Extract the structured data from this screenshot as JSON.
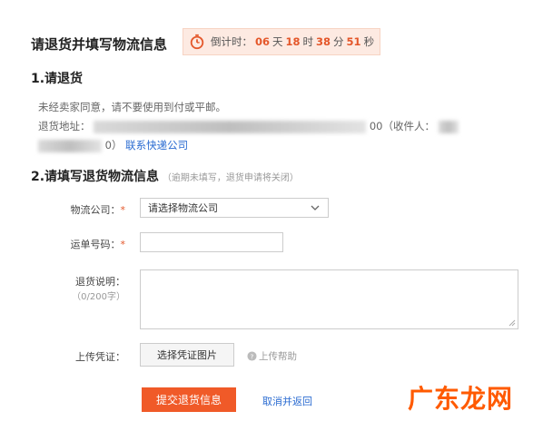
{
  "page_title": "请退货并填写物流信息",
  "countdown": {
    "label": "倒计时：",
    "days": "06",
    "days_unit": "天",
    "hours": "18",
    "hours_unit": "时",
    "minutes": "38",
    "minutes_unit": "分",
    "seconds": "51",
    "seconds_unit": "秒"
  },
  "step1": {
    "title": "1.请退货",
    "note": "未经卖家同意，请不要使用到付或平邮。",
    "address_label": "退货地址：",
    "address_tail": "00（收件人：",
    "phone_tail": "0）",
    "contact_link": "联系快递公司"
  },
  "step2": {
    "title": "2.请填写退货物流信息",
    "hint": "（逾期未填写，退货申请将关闭）",
    "company_label": "物流公司：",
    "company_select": "请选择物流公司",
    "tracking_label": "运单号码：",
    "desc_label": "退货说明：",
    "desc_counter": "（0/200字）",
    "upload_label": "上传凭证：",
    "upload_button": "选择凭证图片",
    "upload_help": "上传帮助",
    "submit_button": "提交退货信息",
    "cancel_link": "取消并返回"
  },
  "watermark": "广东龙网",
  "colors": {
    "accent": "#f05a28",
    "link": "#2a6bd1",
    "countdown_bg": "#fdeae2"
  }
}
